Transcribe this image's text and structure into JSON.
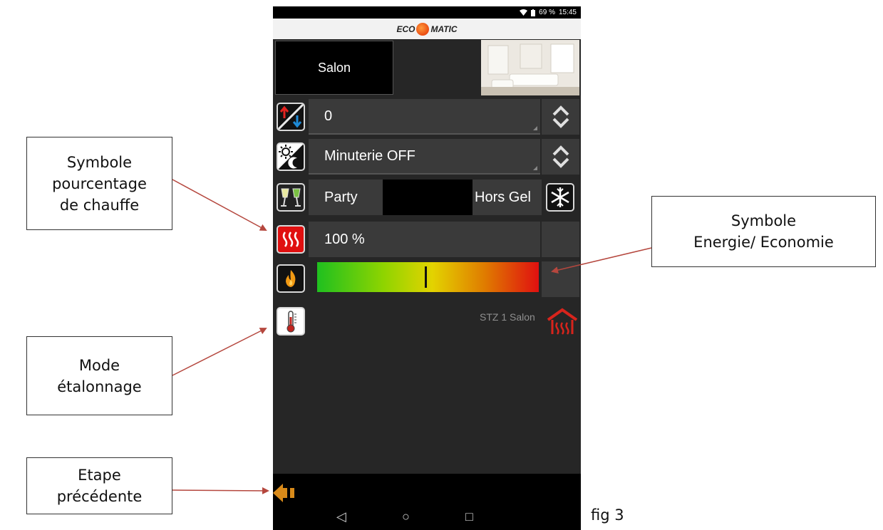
{
  "status_bar": {
    "battery": "69 %",
    "time": "15:45"
  },
  "brand": {
    "left": "ECO",
    "right": "MATIC"
  },
  "room": {
    "name": "Salon"
  },
  "rows": {
    "setpoint_value": "0",
    "timer_value": "Minuterie OFF",
    "party_label": "Party",
    "hors_gel_label": "Hors Gel",
    "heating_percent": "100 %",
    "gauge_level": 0.49
  },
  "device_label": "STZ 1 Salon",
  "callouts": {
    "heating_symbol": "Symbole\npourcentage\nde chauffe",
    "energy_symbol": "Symbole\nEnergie/ Economie",
    "calibration_mode": "Mode\nétalonnage",
    "previous_step": "Etape\nprécédente"
  },
  "figure_caption": "fig 3",
  "icons": [
    "wifi-icon",
    "battery-icon",
    "setpoint-arrows-icon",
    "day-night-icon",
    "party-glasses-icon",
    "snowflake-icon",
    "heating-icon",
    "flame-icon",
    "thermometer-icon",
    "house-heating-icon",
    "spinner-icon",
    "back-arrow-icon",
    "nav-back-icon",
    "nav-home-icon",
    "nav-recents-icon"
  ],
  "colors": {
    "accent_red": "#e01010",
    "arrow_red": "#b5473e",
    "back_orange": "#d88a1a"
  }
}
